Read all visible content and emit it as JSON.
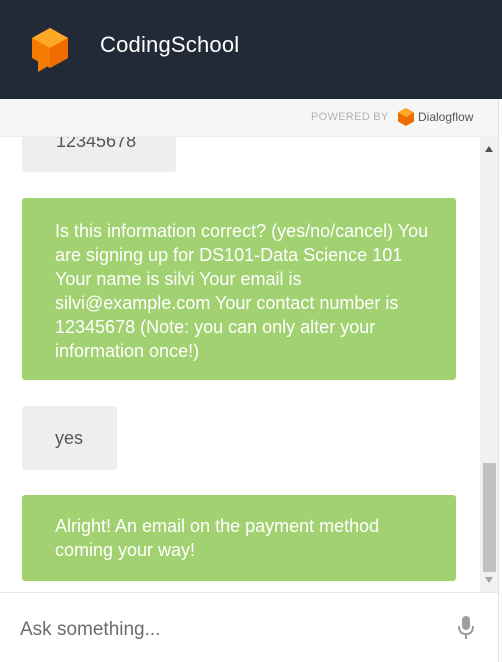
{
  "header": {
    "title": "CodingSchool",
    "logo_icon": "cube-chat-logo-icon",
    "bg_color": "#232a37"
  },
  "powered": {
    "label": "POWERED BY",
    "brand": "Dialogflow",
    "brand_icon": "dialogflow-logo-icon"
  },
  "messages": [
    {
      "role": "user",
      "text": "12345678"
    },
    {
      "role": "bot",
      "text": "Is this information correct? (yes/no/cancel) You are signing up for DS101-Data Science 101 Your name is silvi Your email is silvi@example.com Your contact number is 12345678 (Note: you can only alter your information once!)"
    },
    {
      "role": "user",
      "text": "yes"
    },
    {
      "role": "bot",
      "text": "Alright! An email on the payment method coming your way!"
    }
  ],
  "colors": {
    "bot_bubble": "#a1d171",
    "user_bubble": "#eeeeee"
  },
  "input": {
    "placeholder": "Ask something...",
    "value": "",
    "mic_icon": "microphone-icon"
  }
}
